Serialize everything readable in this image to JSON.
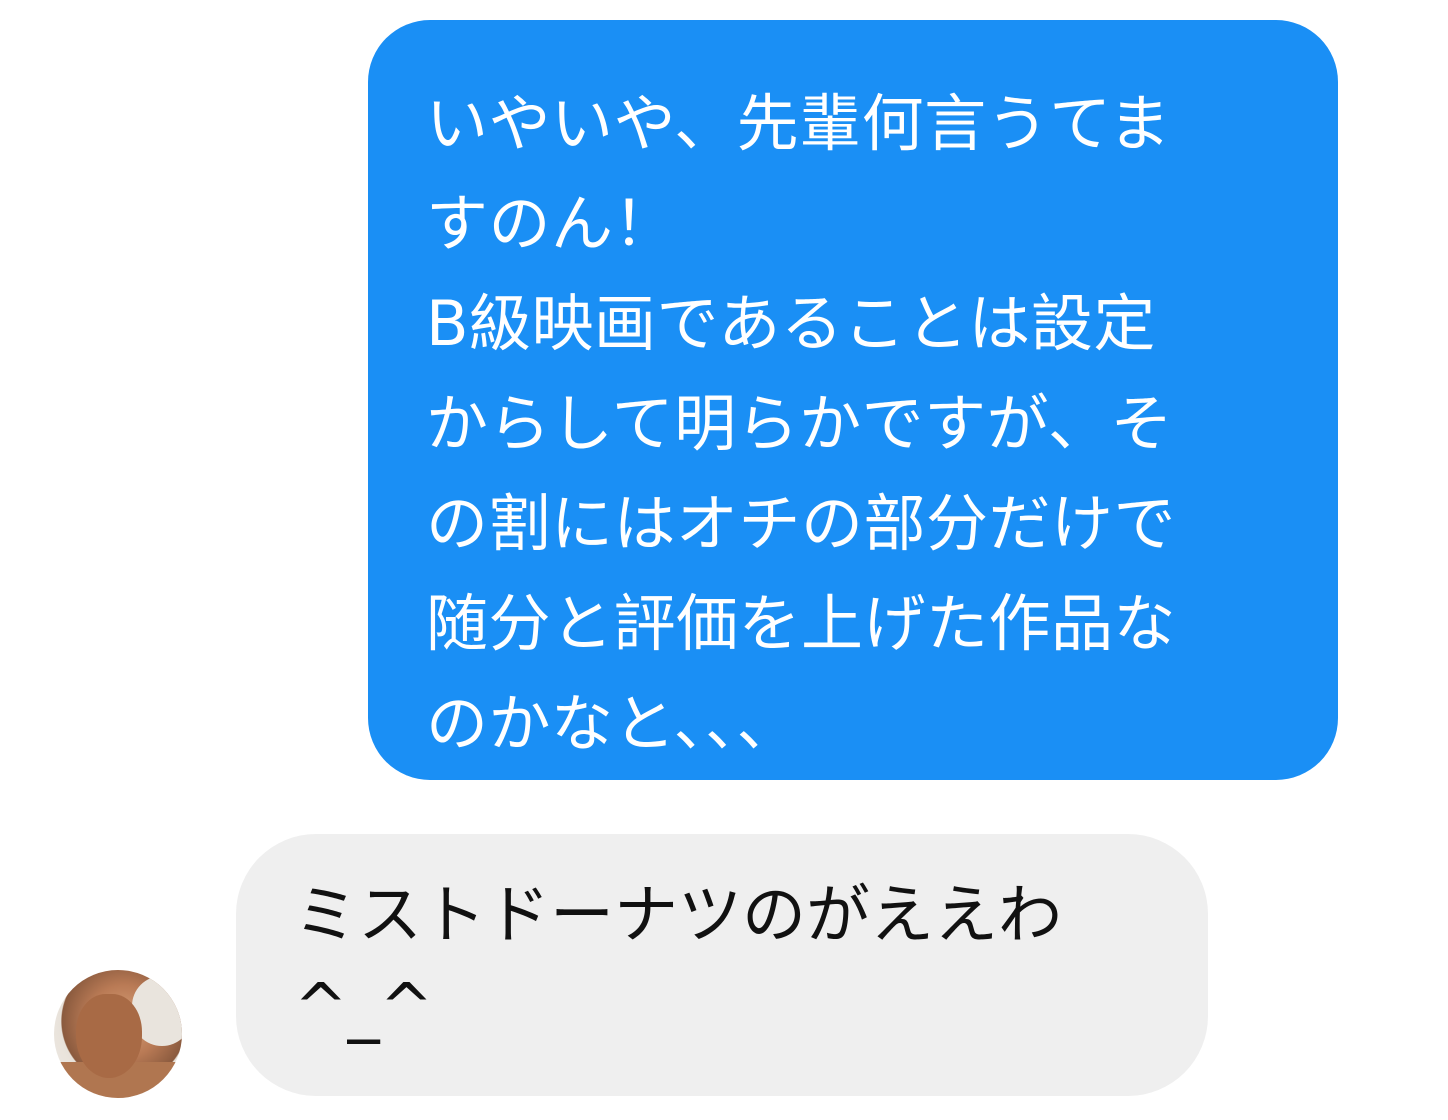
{
  "messages": {
    "outgoing": {
      "lines": [
        "いやいや、先輩何言うてま",
        "すのん！",
        "B級映画であることは設定",
        "からして明らかですが、そ",
        "の割にはオチの部分だけで",
        "随分と評価を上げた作品な",
        "のかなと、、、"
      ],
      "bubble_color": "#1a8ff5",
      "text_color": "#ffffff"
    },
    "incoming": {
      "lines": [
        "ミストドーナツのがええわ",
        "^_^"
      ],
      "bubble_color": "#efefef",
      "text_color": "#111111"
    }
  },
  "avatar": {
    "icon": "user-avatar-photo"
  }
}
